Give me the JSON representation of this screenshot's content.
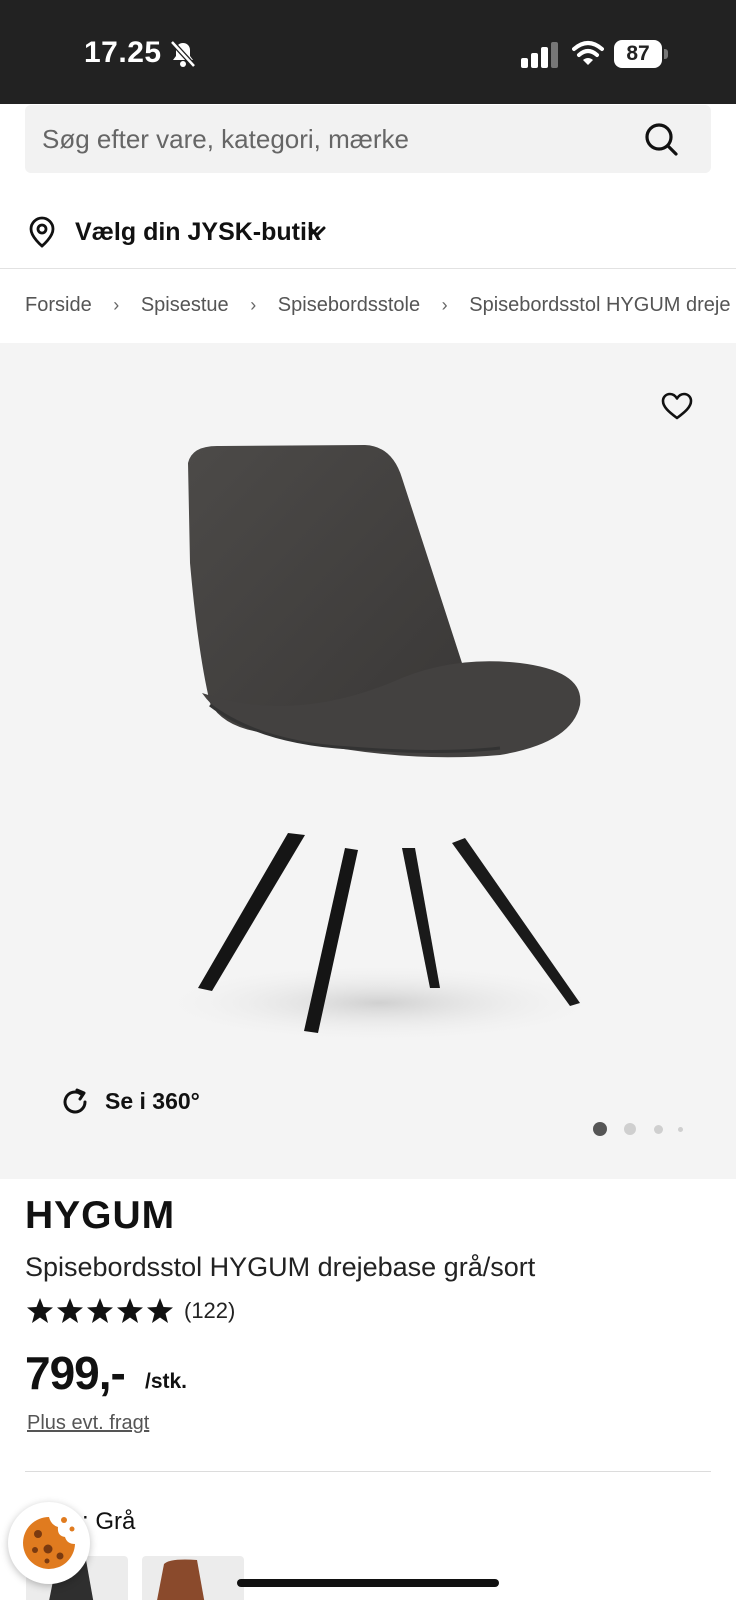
{
  "status_bar": {
    "time": "17.25",
    "battery": "87"
  },
  "search": {
    "placeholder": "Søg efter vare, kategori, mærke"
  },
  "store": {
    "label": "Vælg din JYSK-butik"
  },
  "breadcrumb": [
    "Forside",
    "Spisestue",
    "Spisebordsstole",
    "Spisebordsstol HYGUM dreje"
  ],
  "gallery": {
    "view360_label": "Se i 360°",
    "image_count": 4,
    "active_index": 0
  },
  "product": {
    "brand": "HYGUM",
    "name": "Spisebordsstol HYGUM drejebase grå/sort",
    "rating": 5,
    "review_count": "(122)",
    "price": "799,-",
    "price_unit": "/stk.",
    "shipping_link": "Plus evt. fragt",
    "color_label": ": Grå"
  },
  "colors": {
    "status_bar_bg": "#222222",
    "gallery_bg": "#f4f4f4",
    "text": "#111111",
    "cookie_orange": "#e07b1f"
  }
}
